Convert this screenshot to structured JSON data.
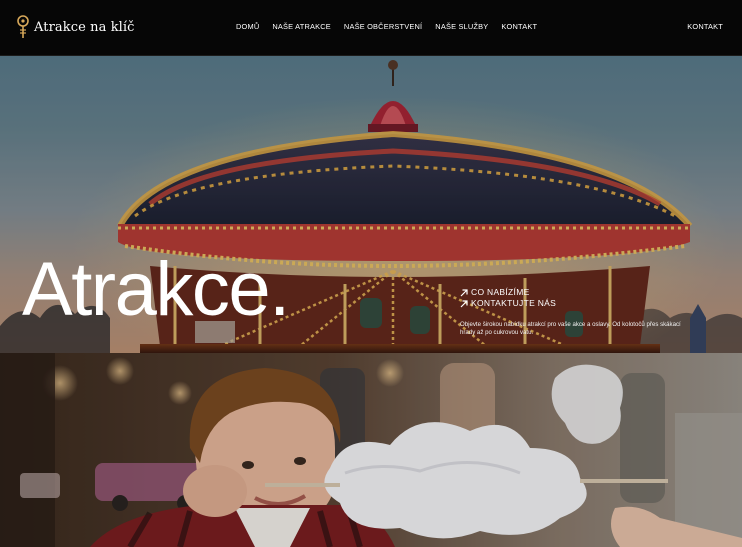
{
  "site": {
    "logo_text": "Atrakce na klíč"
  },
  "nav": {
    "items": [
      {
        "label": "DOMŮ"
      },
      {
        "label": "NAŠE ATRAKCE"
      },
      {
        "label": "NAŠE OBČERSTVENÍ"
      },
      {
        "label": "NAŠE SLUŽBY"
      },
      {
        "label": "KONTAKT"
      }
    ],
    "right_label": "KONTAKT"
  },
  "hero": {
    "title": "Atrakce.",
    "links": [
      {
        "label": "CO NABÍZÍME",
        "icon": "arrow-up-right-icon"
      },
      {
        "label": "KONTAKTUJTE NÁS",
        "icon": "arrow-up-right-icon"
      }
    ],
    "description": "Objevte širokou nabídku atrakcí pro vaše akce a oslavy. Od kolotočů přes skákací hrady až po cukrovou vatu."
  },
  "colors": {
    "header_bg": "#060606",
    "text_light": "#ffffff",
    "carousel_gold": "#f2b84b",
    "carousel_red": "#b3283a"
  },
  "icons": {
    "logo": "lightbulb-logo-icon",
    "link": "arrow-up-right-icon"
  }
}
